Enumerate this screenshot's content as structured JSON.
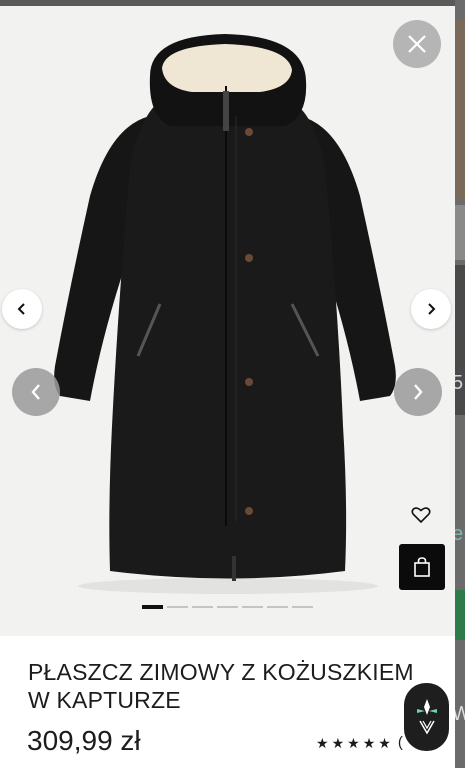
{
  "product": {
    "title_line1": "PŁASZCZ ZIMOWY Z KOŻUSZKIEM",
    "title_line2": "W KAPTURZE",
    "price": "309,99 zł",
    "rating_stars": 5,
    "rating_count": "("
  },
  "gallery": {
    "image_count": 7,
    "active_index": 0
  },
  "background_page": {
    "partial_text_1": "5",
    "partial_text_2": "e",
    "partial_text_3": "W"
  },
  "icons": {
    "close": "close-icon",
    "prev": "chevron-left-icon",
    "next": "chevron-right-icon",
    "favorite": "heart-icon",
    "bag": "shopping-bag-icon",
    "brand": "brand-logo-icon"
  },
  "colors": {
    "accent": "#0b0b0b",
    "coat": "#141414",
    "lining": "#efe6d4",
    "background": "#f2f2f1"
  }
}
